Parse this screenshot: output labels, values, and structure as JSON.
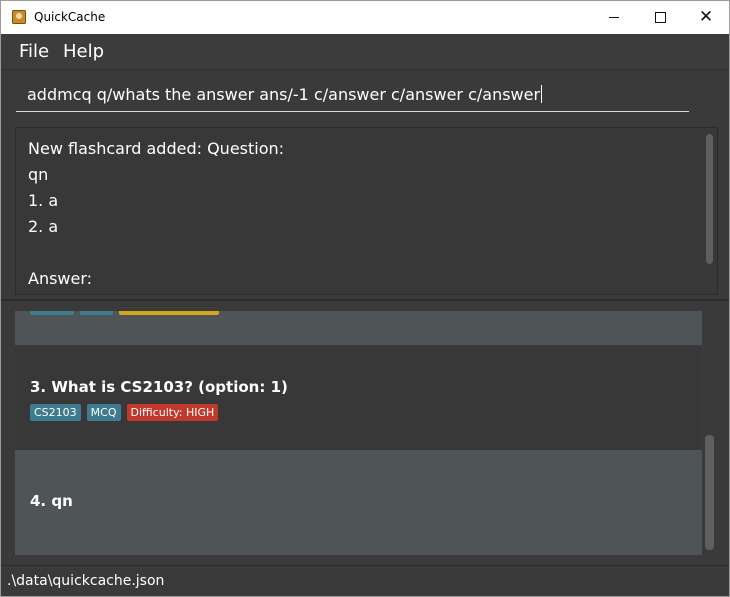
{
  "window": {
    "title": "QuickCache",
    "controls": {
      "minimize": "minimize-icon",
      "maximize": "maximize-icon",
      "close": "close-icon"
    }
  },
  "menu": {
    "file": "File",
    "help": "Help"
  },
  "command": {
    "value": "addmcq q/whats the answer ans/-1 c/answer c/answer c/answer"
  },
  "result": {
    "text": "New flashcard added: Question:\nqn\n1. a\n2. a\n\nAnswer:"
  },
  "flashcards": [
    {
      "index_title": "3.  What is CS2103? (option: 1)",
      "tags": [
        {
          "label": "CS2103",
          "color": "#3e7b91"
        },
        {
          "label": "MCQ",
          "color": "#3e7b91"
        },
        {
          "label": "Difficulty: HIGH",
          "color": "#c0392b"
        }
      ]
    },
    {
      "index_title": "4.  qn",
      "tags": []
    }
  ],
  "status": {
    "path": ".\\data\\quickcache.json"
  },
  "colors": {
    "background": "#3a3a3a",
    "card_alt": "#4f5557",
    "tag_blue": "#3e7b91",
    "tag_red": "#c0392b",
    "tag_yellow": "#d4a51c"
  }
}
